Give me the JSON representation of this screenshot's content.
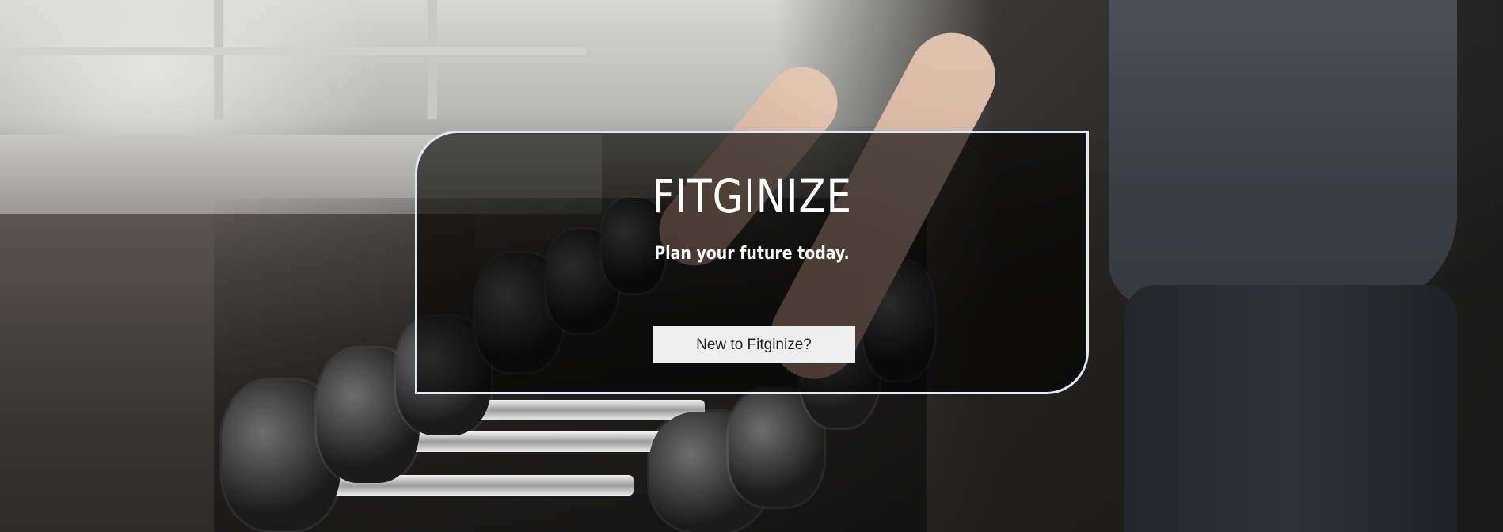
{
  "hero": {
    "title": "FITGINIZE",
    "tagline": "Plan your future today.",
    "cta_label": "New to Fitginize?"
  },
  "theme": {
    "card_border": "#dfe9f4",
    "card_overlay": "rgba(0,0,0,0.62)",
    "button_bg": "#eeeeee",
    "text_color": "#ffffff"
  }
}
